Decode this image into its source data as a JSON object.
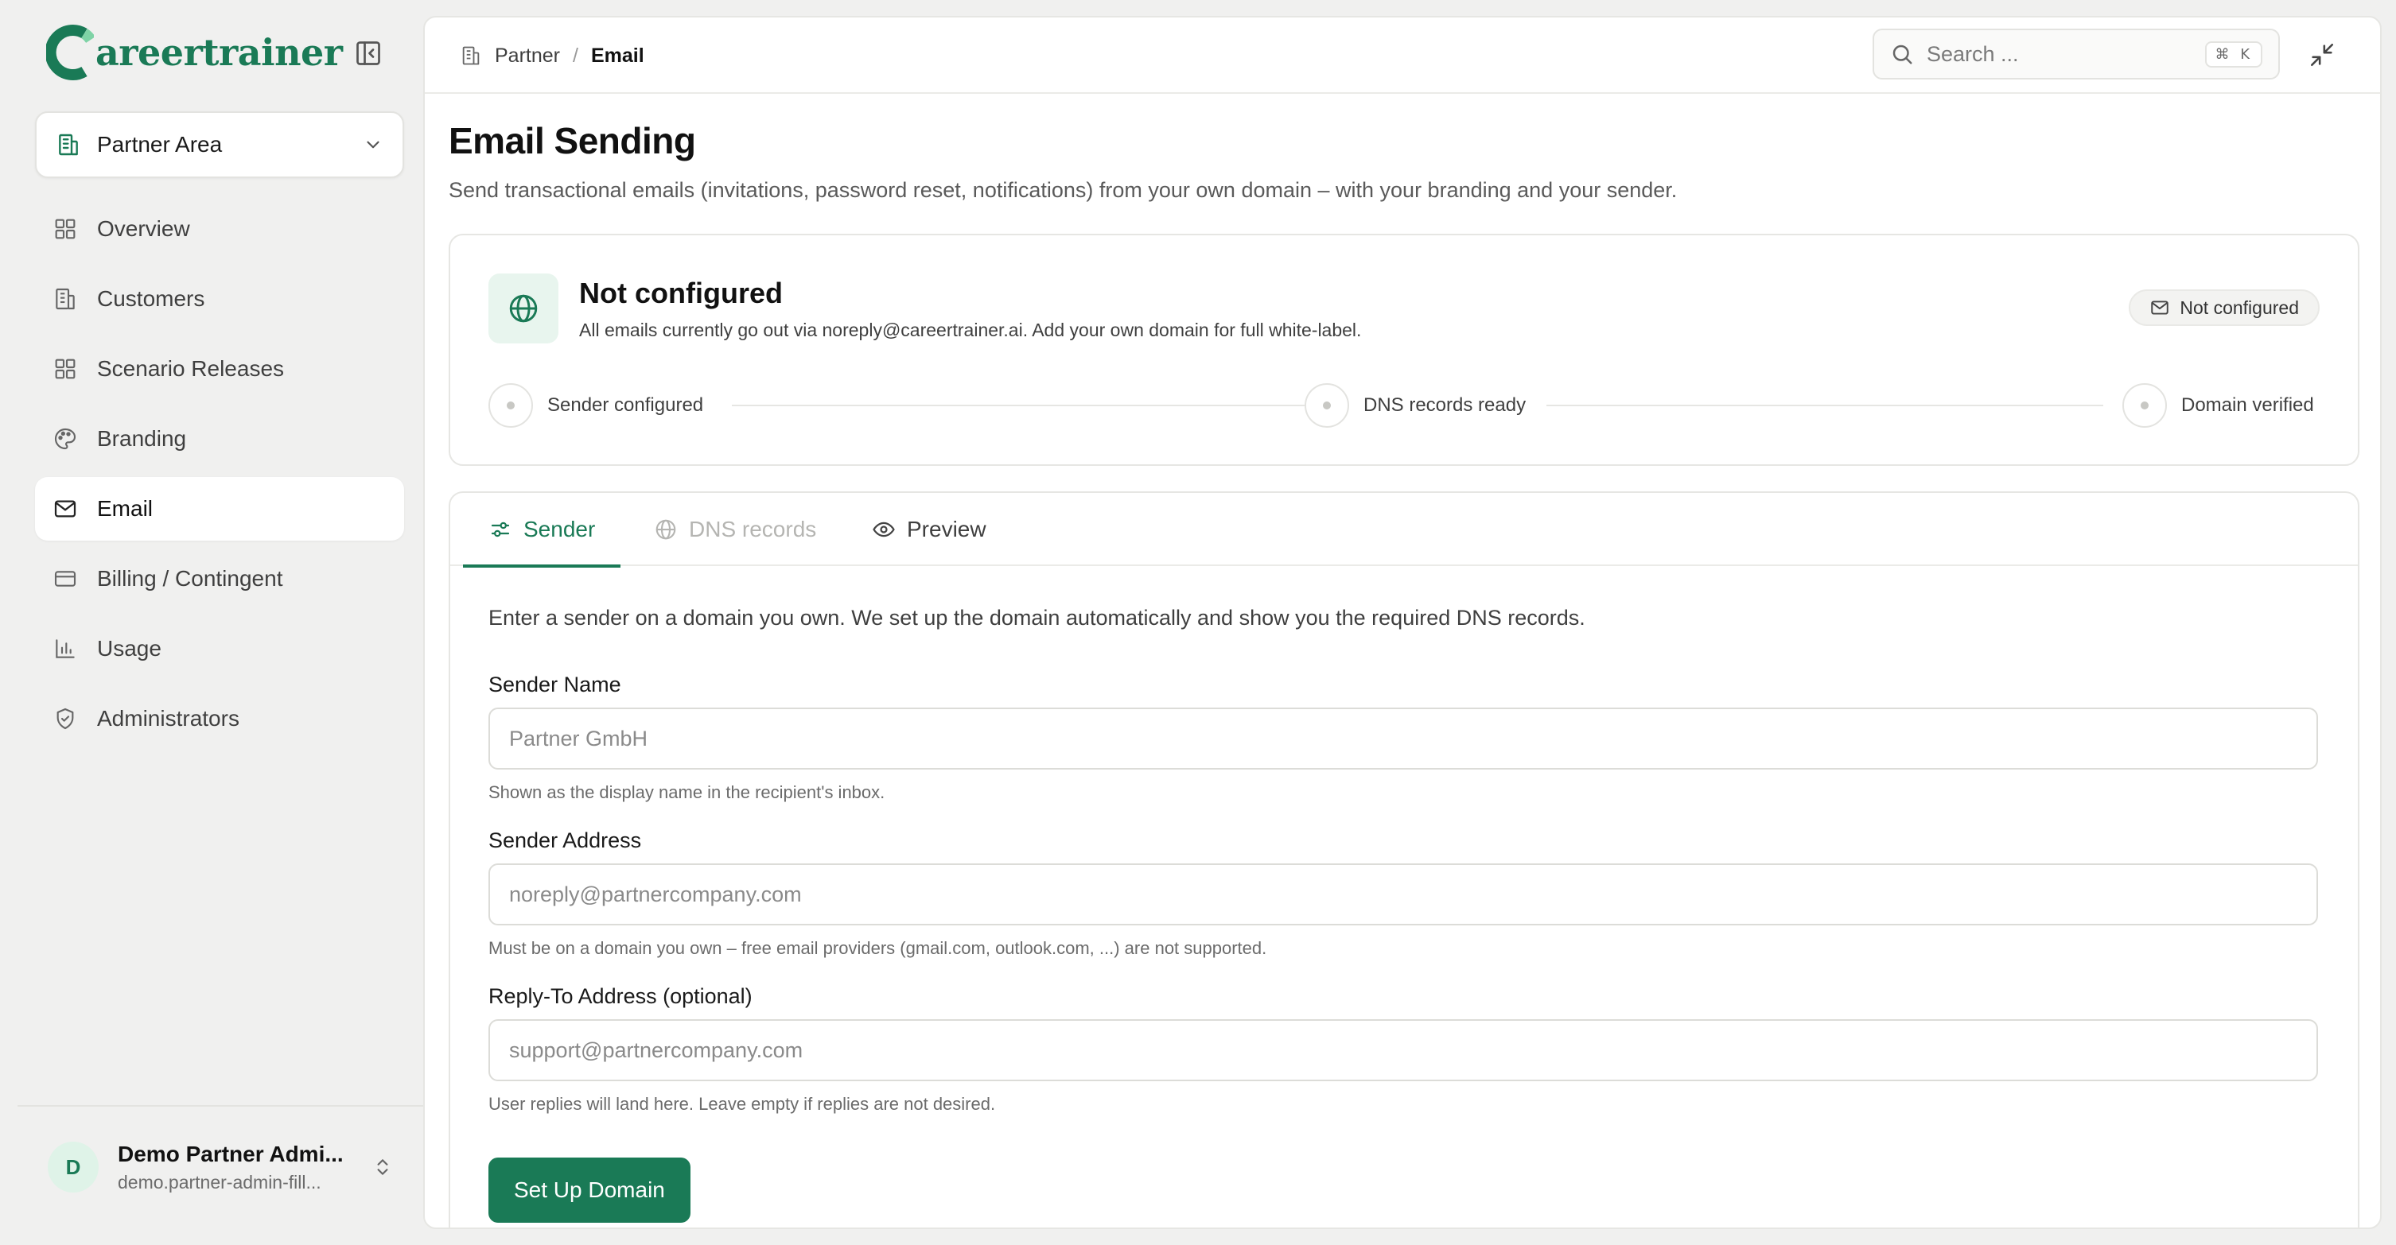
{
  "brand": {
    "logo_text": "areertrainer",
    "accent": "#1a7a56"
  },
  "sidebar": {
    "area": {
      "label": "Partner Area"
    },
    "items": [
      {
        "label": "Overview",
        "icon": "grid-icon"
      },
      {
        "label": "Customers",
        "icon": "building-icon"
      },
      {
        "label": "Scenario Releases",
        "icon": "grid-icon"
      },
      {
        "label": "Branding",
        "icon": "palette-icon"
      },
      {
        "label": "Email",
        "icon": "mail-icon",
        "active": true
      },
      {
        "label": "Billing / Contingent",
        "icon": "credit-card-icon"
      },
      {
        "label": "Usage",
        "icon": "bar-chart-icon"
      },
      {
        "label": "Administrators",
        "icon": "shield-icon"
      }
    ],
    "user": {
      "initial": "D",
      "name": "Demo Partner Admi...",
      "email": "demo.partner-admin-fill..."
    }
  },
  "header": {
    "breadcrumb": {
      "parent": "Partner",
      "separator": "/",
      "current": "Email"
    },
    "search": {
      "placeholder": "Search ...",
      "shortcut": "⌘ K"
    }
  },
  "page": {
    "title": "Email Sending",
    "subtitle": "Send transactional emails (invitations, password reset, notifications) from your own domain – with your branding and your sender."
  },
  "status": {
    "title": "Not configured",
    "description": "All emails currently go out via noreply@careertrainer.ai. Add your own domain for full white-label.",
    "badge": "Not configured",
    "steps": [
      "Sender configured",
      "DNS records ready",
      "Domain verified"
    ]
  },
  "tabs": [
    {
      "label": "Sender",
      "state": "active"
    },
    {
      "label": "DNS records",
      "state": "disabled"
    },
    {
      "label": "Preview",
      "state": "normal"
    }
  ],
  "form": {
    "intro": "Enter a sender on a domain you own. We set up the domain automatically and show you the required DNS records.",
    "sender_name": {
      "label": "Sender Name",
      "value": "",
      "placeholder": "Partner GmbH",
      "hint": "Shown as the display name in the recipient's inbox."
    },
    "sender_address": {
      "label": "Sender Address",
      "value": "",
      "placeholder": "noreply@partnercompany.com",
      "hint": "Must be on a domain you own – free email providers (gmail.com, outlook.com, ...) are not supported."
    },
    "reply_to": {
      "label": "Reply-To Address (optional)",
      "value": "",
      "placeholder": "support@partnercompany.com",
      "hint": "User replies will land here. Leave empty if replies are not desired."
    },
    "submit_label": "Set Up Domain"
  }
}
